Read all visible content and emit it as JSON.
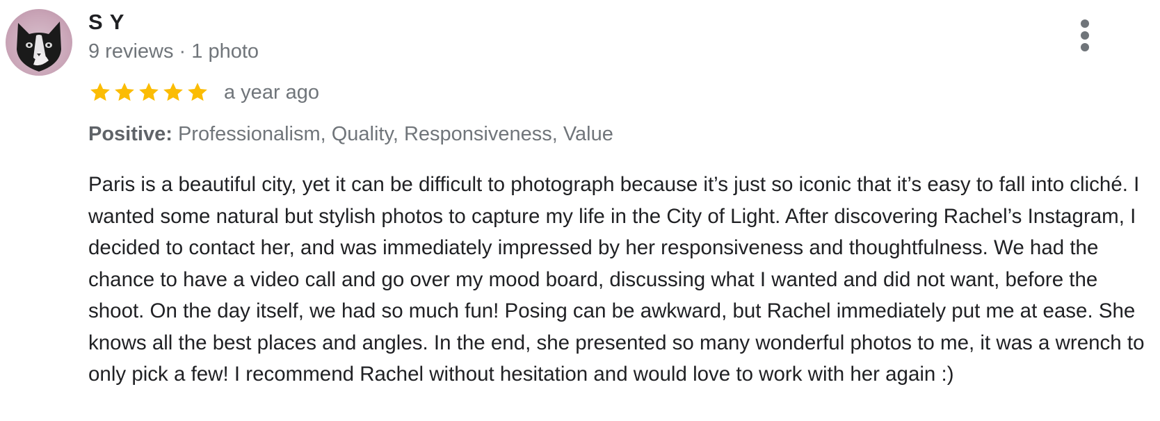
{
  "review": {
    "author": "S Y",
    "meta": "9 reviews · 1 photo",
    "rating": 5,
    "rating_max": 5,
    "time": "a year ago",
    "attributes_label": "Positive:",
    "attributes_values": "Professionalism, Quality, Responsiveness, Value",
    "text": "Paris is a beautiful city, yet it can be difficult to photograph because it’s just so iconic that it’s easy to fall into cliché. I wanted some natural but stylish photos to capture my life in the City of Light. After discovering Rachel’s Instagram, I decided to contact her, and was immediately impressed by her responsiveness and thoughtfulness. We had the chance to have a video call and go over my mood board, discussing what I wanted and did not want, before the shoot. On the day itself, we had so much fun! Posing can be awkward, but Rachel immediately put me at ease. She knows all the best places and angles. In the end, she presented so many wonderful photos to me, it was a wrench to only pick a few! I recommend Rachel without hesitation and would love to work with her again :)"
  },
  "icons": {
    "avatar": "cat-face-avatar",
    "more": "more-vert-icon",
    "star": "star-icon"
  },
  "colors": {
    "star": "#fbbc04",
    "secondary_text": "#70757a",
    "primary_text": "#202124"
  }
}
